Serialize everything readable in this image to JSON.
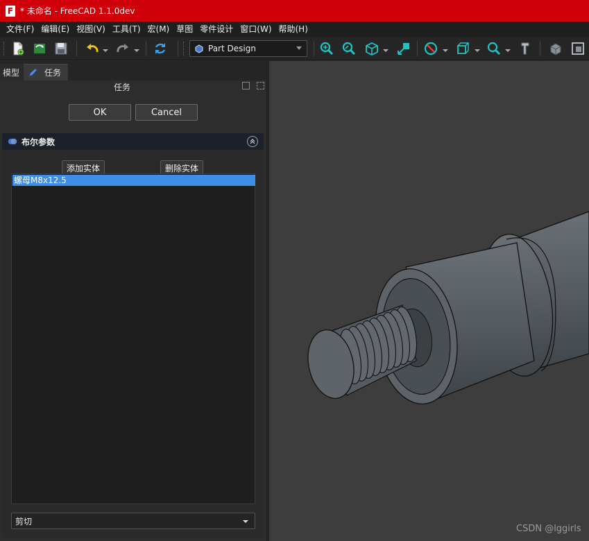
{
  "window": {
    "title": "* 未命名 - FreeCAD 1.1.0dev",
    "logo_letter": "F"
  },
  "menu": [
    "文件(F)",
    "编辑(E)",
    "视图(V)",
    "工具(T)",
    "宏(M)",
    "草图",
    "零件设计",
    "窗口(W)",
    "帮助(H)"
  ],
  "toolbar": {
    "workbench": "Part Design",
    "icons": [
      "new-document-icon",
      "open-document-icon",
      "save-icon",
      "undo-icon",
      "redo-icon",
      "refresh-icon",
      "fit-all-icon",
      "fit-selection-icon",
      "view-cube-icon",
      "align-to-selection-icon",
      "draw-style-icon",
      "bounding-box-icon",
      "zoom-icon",
      "measure-icon",
      "part-icon",
      "group-icon"
    ]
  },
  "left_panel": {
    "tabs": [
      "模型",
      "任务"
    ],
    "title": "任务",
    "ok_label": "OK",
    "cancel_label": "Cancel",
    "boolean": {
      "header": "布尔参数",
      "add_body_label": "添加实体",
      "remove_body_label": "删除实体",
      "bodies": [
        "螺母M8x12.5"
      ],
      "operation": "剪切"
    }
  },
  "viewport": {
    "background": "#3d3d3d",
    "part_color": "#5b6066"
  },
  "watermark": "CSDN @lggirls",
  "colors": {
    "titlebar": "#d0000a",
    "selection": "#3d8ee6"
  }
}
